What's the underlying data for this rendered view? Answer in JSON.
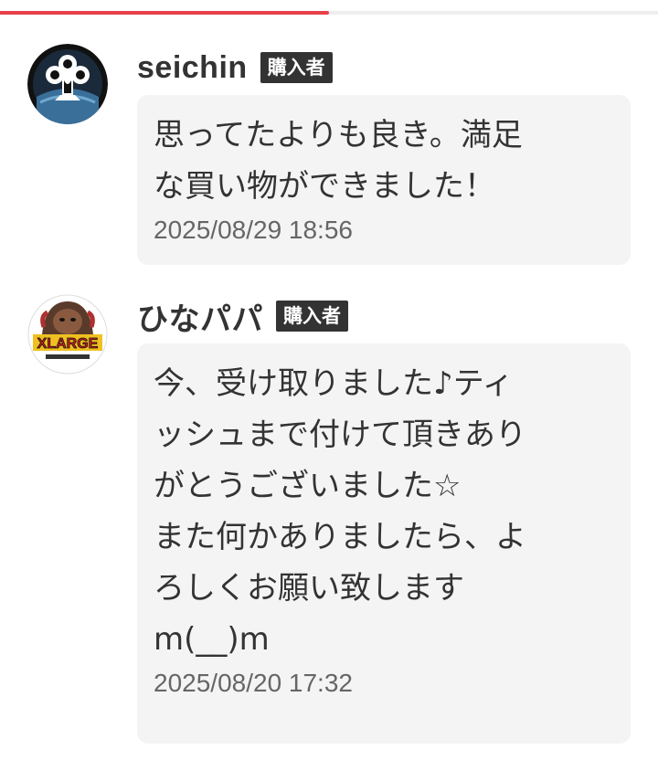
{
  "progress": {
    "fraction": 0.5,
    "color": "#e8404a"
  },
  "reviews": [
    {
      "username": "seichin",
      "badge": "購入者",
      "avatar_icon": "crest-logo-avatar",
      "comment": "思ってたよりも良き。満足\nな買い物ができました！",
      "timestamp": "2025/08/29 18:56"
    },
    {
      "username": "ひなパパ",
      "badge": "購入者",
      "avatar_icon": "xlarge-gorilla-logo-avatar",
      "comment": "今、受け取りました♪ティ\nッシュまで付けて頂きあり\nがとうございました☆\nまた何かありましたら、よ\nろしくお願い致します\nm(__)m",
      "timestamp": "2025/08/20 17:32"
    }
  ]
}
